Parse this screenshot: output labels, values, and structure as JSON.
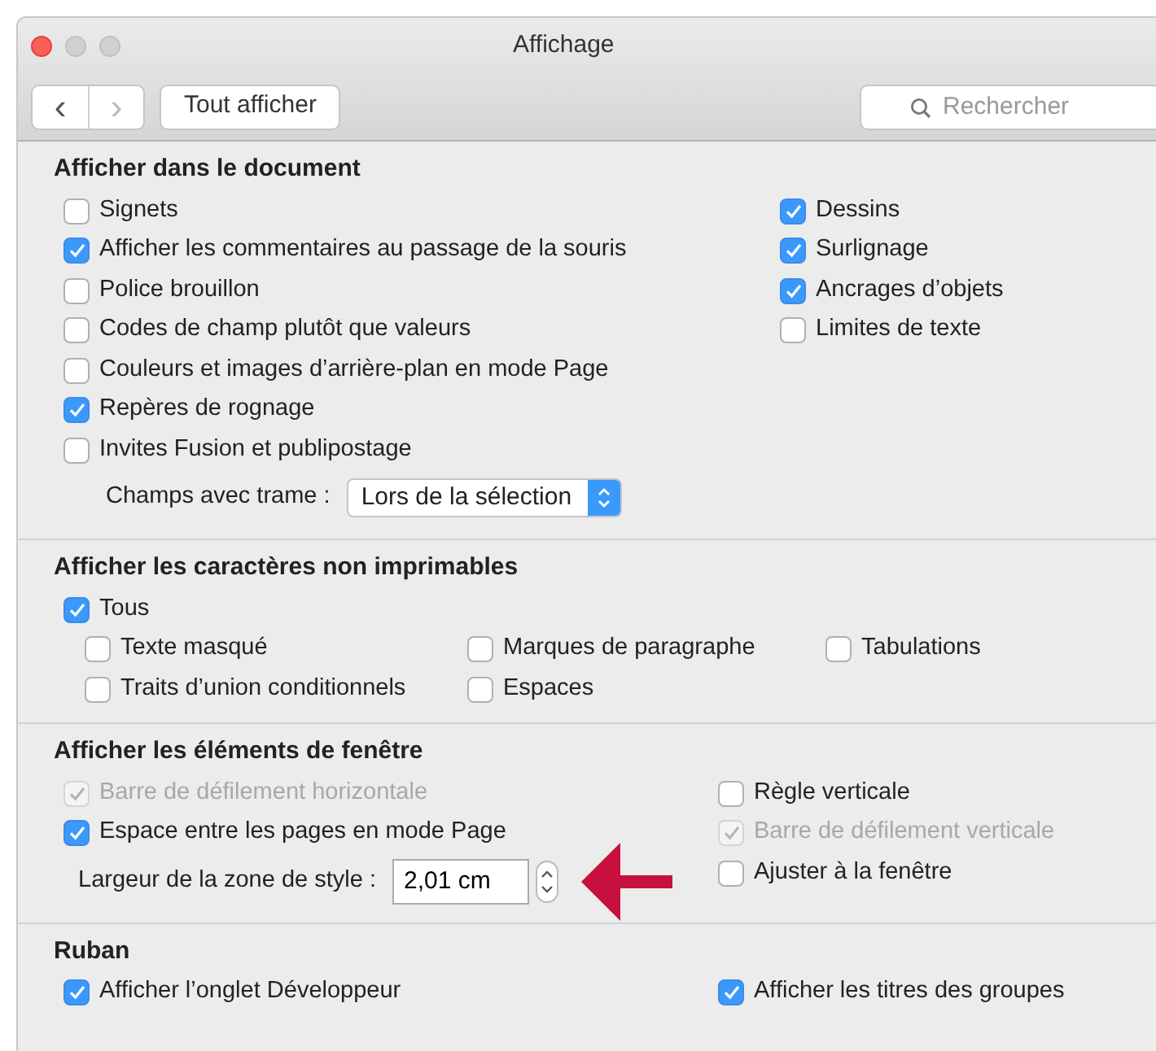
{
  "window": {
    "title": "Affichage"
  },
  "toolbar": {
    "back": "‹",
    "forward": "›",
    "show_all": "Tout afficher",
    "search": {
      "placeholder": "Rechercher"
    }
  },
  "sections": [
    {
      "title": "Afficher dans le document",
      "columns": [
        [
          {
            "kind": "checkbox",
            "label": "Signets",
            "checked": false,
            "disabled": false
          },
          {
            "kind": "checkbox",
            "label": "Afficher les commentaires au passage de la souris",
            "checked": true,
            "disabled": false
          },
          {
            "kind": "checkbox",
            "label": "Police brouillon",
            "checked": false,
            "disabled": false
          },
          {
            "kind": "checkbox",
            "label": "Codes de champ plutôt que valeurs",
            "checked": false,
            "disabled": false
          },
          {
            "kind": "checkbox",
            "label": "Couleurs et images d’arrière-plan en mode Page",
            "checked": false,
            "disabled": false
          },
          {
            "kind": "checkbox",
            "label": "Repères de rognage",
            "checked": true,
            "disabled": false
          },
          {
            "kind": "checkbox",
            "label": "Invites Fusion et publipostage",
            "checked": false,
            "disabled": false
          },
          {
            "kind": "select",
            "label": "Champs avec trame :",
            "value": "Lors de la sélection"
          }
        ],
        [
          {
            "kind": "checkbox",
            "label": "Dessins",
            "checked": true,
            "disabled": false
          },
          {
            "kind": "checkbox",
            "label": "Surlignage",
            "checked": true,
            "disabled": false
          },
          {
            "kind": "checkbox",
            "label": "Ancrages d’objets",
            "checked": true,
            "disabled": false
          },
          {
            "kind": "checkbox",
            "label": "Limites de texte",
            "checked": false,
            "disabled": false
          }
        ]
      ]
    },
    {
      "title": "Afficher les caractères non imprimables",
      "lead": {
        "kind": "checkbox",
        "label": "Tous",
        "checked": true,
        "disabled": false
      },
      "columns": [
        [
          {
            "kind": "checkbox",
            "label": "Texte masqué",
            "checked": false,
            "disabled": false
          },
          {
            "kind": "checkbox",
            "label": "Traits d’union conditionnels",
            "checked": false,
            "disabled": false
          }
        ],
        [
          {
            "kind": "checkbox",
            "label": "Marques de paragraphe",
            "checked": false,
            "disabled": false
          },
          {
            "kind": "checkbox",
            "label": "Espaces",
            "checked": false,
            "disabled": false
          }
        ],
        [
          {
            "kind": "checkbox",
            "label": "Tabulations",
            "checked": false,
            "disabled": false
          }
        ]
      ]
    },
    {
      "title": "Afficher les éléments de fenêtre",
      "columns": [
        [
          {
            "kind": "checkbox",
            "label": "Barre de défilement horizontale",
            "checked": true,
            "disabled": true
          },
          {
            "kind": "checkbox",
            "label": "Espace entre les pages en mode Page",
            "checked": true,
            "disabled": false
          },
          {
            "kind": "spin",
            "label": "Largeur de la zone de style :",
            "value": "2,01 cm",
            "annotated": true
          }
        ],
        [
          {
            "kind": "checkbox",
            "label": "Règle verticale",
            "checked": false,
            "disabled": false
          },
          {
            "kind": "checkbox",
            "label": "Barre de défilement verticale",
            "checked": true,
            "disabled": true
          },
          {
            "kind": "checkbox",
            "label": "Ajuster à la fenêtre",
            "checked": false,
            "disabled": false
          }
        ]
      ]
    },
    {
      "title": "Ruban",
      "columns": [
        [
          {
            "kind": "checkbox",
            "label": "Afficher l’onglet Développeur",
            "checked": true,
            "disabled": false
          }
        ],
        [
          {
            "kind": "checkbox",
            "label": "Afficher les titres des groupes",
            "checked": true,
            "disabled": false
          }
        ]
      ]
    }
  ]
}
